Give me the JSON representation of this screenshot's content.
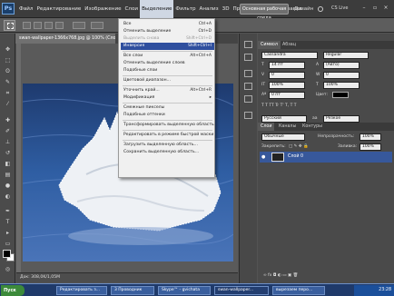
{
  "app": {
    "logo_text": "Ps"
  },
  "menu": {
    "items": [
      "Файл",
      "Редактирование",
      "Изображение",
      "Слои",
      "Выделение",
      "Фильтр",
      "Анализ",
      "3D",
      "Просмотр",
      "Окно",
      "Справка"
    ],
    "active_index": 4
  },
  "workspace": {
    "button_label": "Основная рабочая среда",
    "design_label": "Дизайн",
    "cslive_label": "CS Live"
  },
  "document": {
    "tab_label": "swan-wallpaper-1366x768.jpg @ 100% (Слой 0, RGB/8)",
    "status_text": "Док: 308,0K/1,05M"
  },
  "select_menu": {
    "items": [
      {
        "label": "Все",
        "shortcut": "Ctrl+A",
        "disabled": false
      },
      {
        "label": "Отменить выделение",
        "shortcut": "Ctrl+D",
        "disabled": false
      },
      {
        "label": "Выделить снова",
        "shortcut": "Shift+Ctrl+D",
        "disabled": true
      },
      {
        "label": "Инверсия",
        "shortcut": "Shift+Ctrl+I",
        "disabled": false,
        "highlighted": true
      },
      {
        "separator": true
      },
      {
        "label": "Все слои",
        "shortcut": "Alt+Ctrl+A",
        "disabled": false
      },
      {
        "label": "Отменить выделение слоев",
        "shortcut": "",
        "disabled": false
      },
      {
        "label": "Подобные слои",
        "shortcut": "",
        "disabled": false
      },
      {
        "separator": true
      },
      {
        "label": "Цветовой диапазон...",
        "shortcut": "",
        "disabled": false
      },
      {
        "separator": true
      },
      {
        "label": "Уточнить край...",
        "shortcut": "Alt+Ctrl+R",
        "disabled": false
      },
      {
        "label": "Модификация",
        "shortcut": "",
        "disabled": false,
        "submenu": true
      },
      {
        "separator": true
      },
      {
        "label": "Смежные пикселы",
        "shortcut": "",
        "disabled": false
      },
      {
        "label": "Подобные оттенки",
        "shortcut": "",
        "disabled": false
      },
      {
        "separator": true
      },
      {
        "label": "Трансформировать выделенную область",
        "shortcut": "",
        "disabled": false
      },
      {
        "separator": true
      },
      {
        "label": "Редактировать в режиме быстрой маски",
        "shortcut": "",
        "disabled": false
      },
      {
        "separator": true
      },
      {
        "label": "Загрузить выделенную область...",
        "shortcut": "",
        "disabled": false
      },
      {
        "label": "Сохранить выделенную область...",
        "shortcut": "",
        "disabled": false
      }
    ]
  },
  "character_panel": {
    "tabs": [
      "Символ",
      "Абзац"
    ],
    "font_family": "Cassandra",
    "font_style": "Regular",
    "font_size": "14 пт",
    "leading": "(Авто)",
    "kerning": "0",
    "tracking": "0",
    "vscale": "100%",
    "hscale": "100%",
    "baseline": "0 пт",
    "color_label": "Цвет:",
    "language": "Русский",
    "antialias": "Резкое"
  },
  "layers_panel": {
    "tabs": [
      "Слои",
      "Каналы",
      "Контуры"
    ],
    "blend_mode": "Обычные",
    "opacity_label": "Непрозрачность:",
    "opacity_value": "100%",
    "lock_label": "Закрепить:",
    "fill_label": "Заливка:",
    "fill_value": "100%",
    "layer_name": "Слой 0"
  },
  "taskbar": {
    "start_label": "Пуск",
    "tasks": [
      {
        "label": "Редактировать з...",
        "active": false
      },
      {
        "label": "3 Проводник",
        "active": false
      },
      {
        "label": "Skype™ - gvichata",
        "active": false
      },
      {
        "label": "swan-wallpaper...",
        "active": true
      },
      {
        "label": "вырезаем перо...",
        "active": false
      }
    ],
    "clock": "23:28"
  },
  "colors": {
    "menu_highlight": "#2f4f9e",
    "layer_selected": "#37589b",
    "water_dark": "#1e3a6e",
    "water_light": "#4a74b8"
  }
}
